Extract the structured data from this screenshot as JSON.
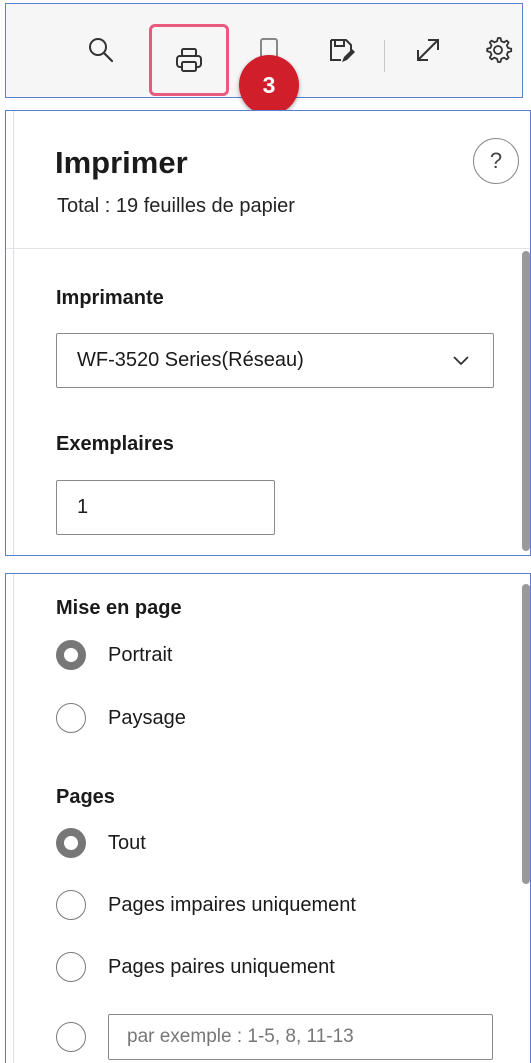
{
  "toolbar": {
    "icons": [
      "search-icon",
      "printer-icon",
      "save-as-icon",
      "expand-icon",
      "gear-icon"
    ],
    "step_badge": "3",
    "highlight_color": "#e85a7f",
    "badge_color": "#d01e2a"
  },
  "print_panel": {
    "title": "Imprimer",
    "subtitle": "Total : 19 feuilles de papier",
    "help": "?",
    "printer": {
      "label": "Imprimante",
      "value": "WF-3520 Series(Réseau)"
    },
    "copies": {
      "label": "Exemplaires",
      "value": "1"
    }
  },
  "layout_section": {
    "label": "Mise en page",
    "options": [
      {
        "label": "Portrait",
        "checked": true
      },
      {
        "label": "Paysage",
        "checked": false
      }
    ]
  },
  "pages_section": {
    "label": "Pages",
    "options": [
      {
        "label": "Tout",
        "checked": true
      },
      {
        "label": "Pages impaires uniquement",
        "checked": false
      },
      {
        "label": "Pages paires uniquement",
        "checked": false
      }
    ],
    "custom_placeholder": "par exemple : 1-5, 8, 11-13"
  }
}
